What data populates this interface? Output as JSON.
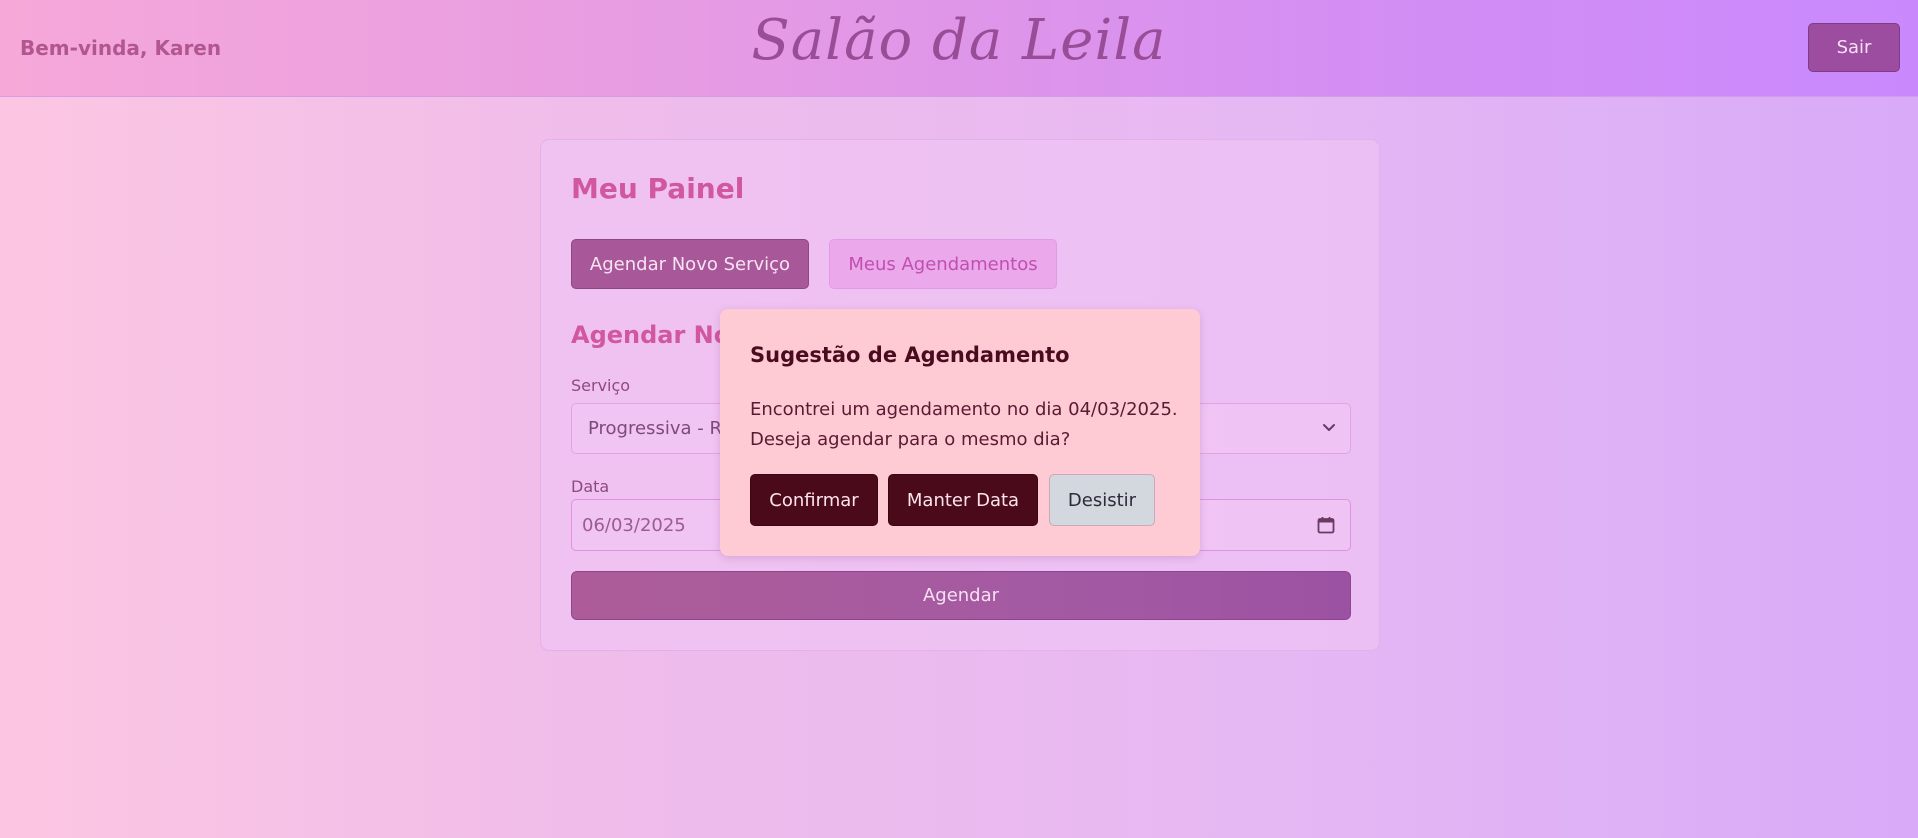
{
  "header": {
    "welcome": "Bem-vinda, Karen",
    "brand": "Salão da Leila",
    "logout_label": "Sair"
  },
  "panel": {
    "title": "Meu Painel",
    "tabs": [
      {
        "label": "Agendar Novo Serviço",
        "active": true
      },
      {
        "label": "Meus Agendamentos",
        "active": false
      }
    ],
    "section_title": "Agendar Novo Serviço",
    "service_label": "Serviço",
    "service_value": "Progressiva - R$",
    "date_label": "Data",
    "date_value": "06/03/2025",
    "submit_label": "Agendar"
  },
  "modal": {
    "title": "Sugestão de Agendamento",
    "message": "Encontrei um agendamento no dia 04/03/2025. Deseja agendar para o mesmo dia?",
    "confirm_label": "Confirmar",
    "keep_date_label": "Manter Data",
    "cancel_label": "Desistir"
  },
  "icons": {
    "select": "chevron-down-icon",
    "date": "calendar-icon"
  },
  "colors": {
    "accent": "#d1579e",
    "primary_button": "#a85898",
    "modal_background": "#fecbd5",
    "modal_button": "#4a0a1a"
  }
}
